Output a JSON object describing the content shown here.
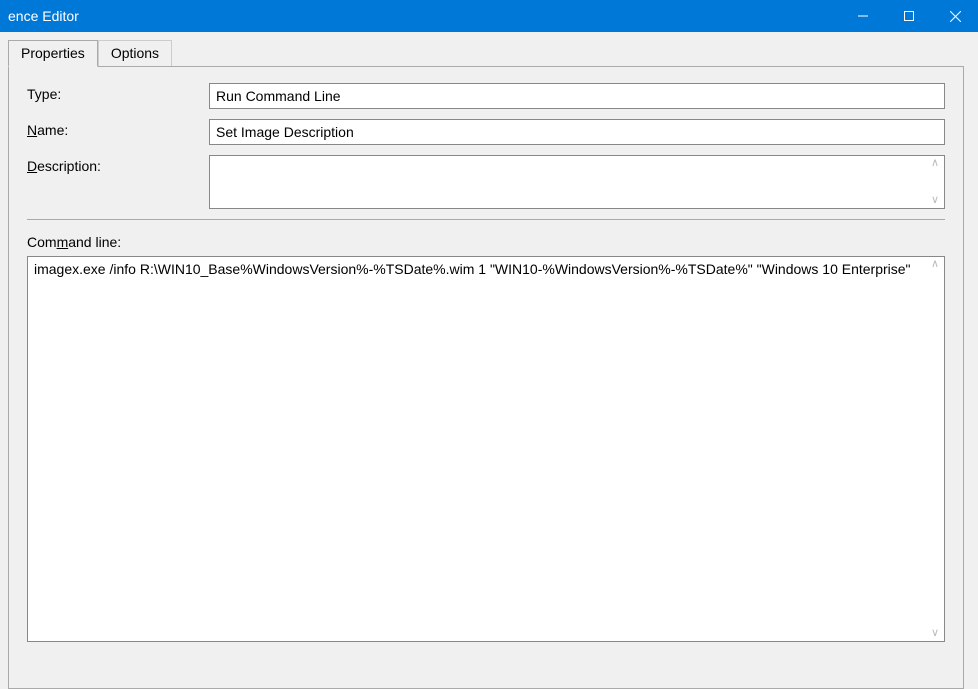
{
  "window": {
    "title": "ence Editor"
  },
  "tabs": {
    "properties": "Properties",
    "options": "Options"
  },
  "form": {
    "type_label": "Type:",
    "type_value": "Run Command Line",
    "name_label_prefix": "",
    "name_label_underlined": "N",
    "name_label_suffix": "ame:",
    "name_value": "Set Image Description",
    "desc_label_underlined": "D",
    "desc_label_suffix": "escription:",
    "desc_value": ""
  },
  "command": {
    "label_prefix": "Com",
    "label_underlined": "m",
    "label_suffix": "and line:",
    "value": "imagex.exe /info R:\\WIN10_Base%WindowsVersion%-%TSDate%.wim 1 \"WIN10-%WindowsVersion%-%TSDate%\" \"Windows 10 Enterprise\""
  }
}
